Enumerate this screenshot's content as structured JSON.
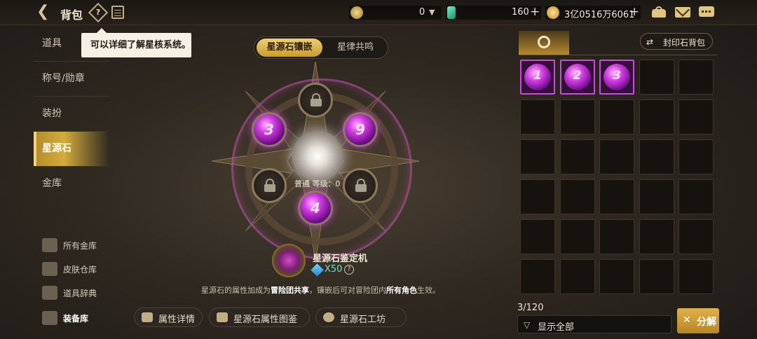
{
  "header": {
    "title": "背包",
    "help_icon_glyph": "?",
    "currencies": [
      {
        "icon": "gold-dial-icon",
        "value": "0",
        "suffix": "▼"
      },
      {
        "icon": "green-crystal-icon",
        "value": "160",
        "suffix": "+"
      },
      {
        "icon": "gold-coin-icon",
        "value": "3亿0516万6061",
        "suffix": "+"
      }
    ]
  },
  "sidebar": {
    "items": [
      {
        "label": "道具"
      },
      {
        "label": "称号/勋章"
      },
      {
        "label": "装扮"
      },
      {
        "label": "星源石"
      },
      {
        "label": "金库"
      }
    ],
    "lower": [
      {
        "label": "所有金库"
      },
      {
        "label": "皮肤仓库"
      },
      {
        "label": "道具辞典"
      },
      {
        "label": "装备库"
      }
    ]
  },
  "tooltip": {
    "text": "可以详细了解星核系统。"
  },
  "tabs": [
    {
      "label": "星源石镶嵌"
    },
    {
      "label": "星律共鸣"
    }
  ],
  "star_map": {
    "level_text": "普通 等级：0",
    "slots": [
      {
        "type": "lock",
        "label": ""
      },
      {
        "type": "gem",
        "label": "3"
      },
      {
        "type": "gem",
        "label": "9"
      },
      {
        "type": "lock",
        "label": ""
      },
      {
        "type": "lock",
        "label": ""
      },
      {
        "type": "gem",
        "label": "4"
      }
    ]
  },
  "machine": {
    "title": "星源石鉴定机",
    "count": "X50",
    "help_glyph": "?"
  },
  "description": {
    "part1": "星源石的属性加成为",
    "bold1": "冒险团共享",
    "part2": "，镶嵌后可对冒险团内",
    "bold2": "所有角色",
    "part3": "生效。"
  },
  "bottom_buttons": [
    {
      "label": "属性详情"
    },
    {
      "label": "星源石属性图鉴"
    },
    {
      "label": "星源石工坊"
    }
  ],
  "right_panel": {
    "seal_button": "封印石背包",
    "seal_icon": "⇄",
    "items": [
      "1",
      "2",
      "3"
    ],
    "total_cells": 30,
    "count_text": "3/120",
    "filter_label": "显示全部",
    "filter_icon": "filter-icon",
    "decompose_label": "分解",
    "decompose_icon": "✕"
  },
  "colors": {
    "accent_gold": "#d4ab3c",
    "gem_purple": "#d03ce0",
    "count_green": "#6fe0c2"
  }
}
